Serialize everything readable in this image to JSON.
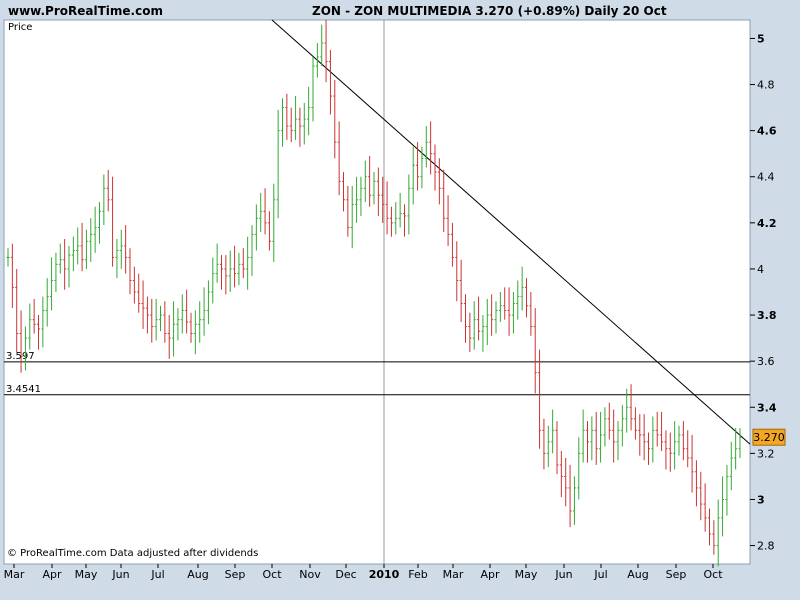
{
  "header": {
    "site": "www.ProRealTime.com",
    "title": "ZON - ZON MULTIMEDIA   3.270 (+0.89%)   Daily  20 Oct"
  },
  "footer_note": "© ProRealTime.com  Data adjusted after dividends",
  "price_label": "Price",
  "last_price_label": "3.270",
  "colors": {
    "background": "#cfdbe6",
    "plot_background": "#ffffff",
    "up": "#33aa33",
    "down": "#cc3333",
    "line": "#000000",
    "last_price": "#f5a623",
    "separator": "#999999"
  },
  "chart_data": {
    "type": "ohlc",
    "title": "ZON - ZON MULTIMEDIA",
    "ylabel": "Price",
    "y_ticks": [
      2.8,
      3,
      3.2,
      3.4,
      3.6,
      3.8,
      4,
      4.2,
      4.4,
      4.6,
      4.8,
      5
    ],
    "y_tick_labels": [
      "2.8",
      "3",
      "3.2",
      "3.4",
      "3.6",
      "3.8",
      "4",
      "4.2",
      "4.4",
      "4.6",
      "4.8",
      "5"
    ],
    "x_ticks": [
      "Mar",
      "Apr",
      "May",
      "Jun",
      "Jul",
      "Aug",
      "Sep",
      "Oct",
      "Nov",
      "Dec",
      "2010",
      "Feb",
      "Mar",
      "Apr",
      "May",
      "Jun",
      "Jul",
      "Aug",
      "Sep",
      "Oct"
    ],
    "year_separator": "2010",
    "ylim": [
      2.72,
      5.08
    ],
    "horizontal_lines": [
      {
        "label": "3.597",
        "value": 3.597
      },
      {
        "label": "3.4541",
        "value": 3.4541
      }
    ],
    "trendline": {
      "from": {
        "month": "Oct",
        "value": 5.08
      },
      "to": {
        "month": "Oct",
        "value": 3.24
      }
    },
    "last_price": 3.27,
    "closes": [
      4.05,
      3.92,
      3.72,
      3.62,
      3.7,
      3.78,
      3.76,
      3.74,
      3.82,
      3.88,
      3.95,
      4.02,
      4.04,
      4.0,
      4.06,
      4.08,
      4.1,
      4.04,
      4.12,
      4.15,
      4.18,
      4.25,
      4.35,
      4.3,
      4.05,
      4.08,
      4.1,
      4.05,
      3.95,
      3.9,
      3.85,
      3.83,
      3.8,
      3.75,
      3.78,
      3.8,
      3.72,
      3.7,
      3.76,
      3.78,
      3.82,
      3.77,
      3.72,
      3.76,
      3.78,
      3.82,
      3.9,
      3.98,
      4.02,
      4.0,
      3.97,
      4.0,
      3.98,
      4.02,
      4.0,
      4.05,
      4.15,
      4.22,
      4.25,
      4.2,
      4.12,
      4.3,
      4.6,
      4.7,
      4.62,
      4.6,
      4.65,
      4.62,
      4.65,
      4.7,
      4.88,
      4.92,
      4.98,
      4.9,
      4.75,
      4.55,
      4.38,
      4.3,
      4.18,
      4.28,
      4.3,
      4.35,
      4.4,
      4.32,
      4.38,
      4.32,
      4.28,
      4.22,
      4.2,
      4.22,
      4.24,
      4.23,
      4.35,
      4.45,
      4.4,
      4.48,
      4.55,
      4.5,
      4.42,
      4.35,
      4.22,
      4.15,
      4.05,
      3.95,
      3.85,
      3.75,
      3.7,
      3.78,
      3.73,
      3.75,
      3.8,
      3.78,
      3.82,
      3.84,
      3.82,
      3.8,
      3.85,
      3.88,
      3.92,
      3.84,
      3.75,
      3.55,
      3.3,
      3.2,
      3.25,
      3.3,
      3.15,
      3.1,
      3.05,
      2.95,
      3.05,
      3.2,
      3.3,
      3.25,
      3.3,
      3.22,
      3.28,
      3.35,
      3.3,
      3.25,
      3.3,
      3.35,
      3.4,
      3.35,
      3.3,
      3.28,
      3.25,
      3.22,
      3.3,
      3.28,
      3.25,
      3.22,
      3.2,
      3.25,
      3.28,
      3.22,
      3.18,
      3.12,
      3.05,
      2.98,
      2.92,
      2.85,
      2.8,
      2.92,
      3.0,
      3.1,
      3.18,
      3.22,
      3.27
    ]
  }
}
